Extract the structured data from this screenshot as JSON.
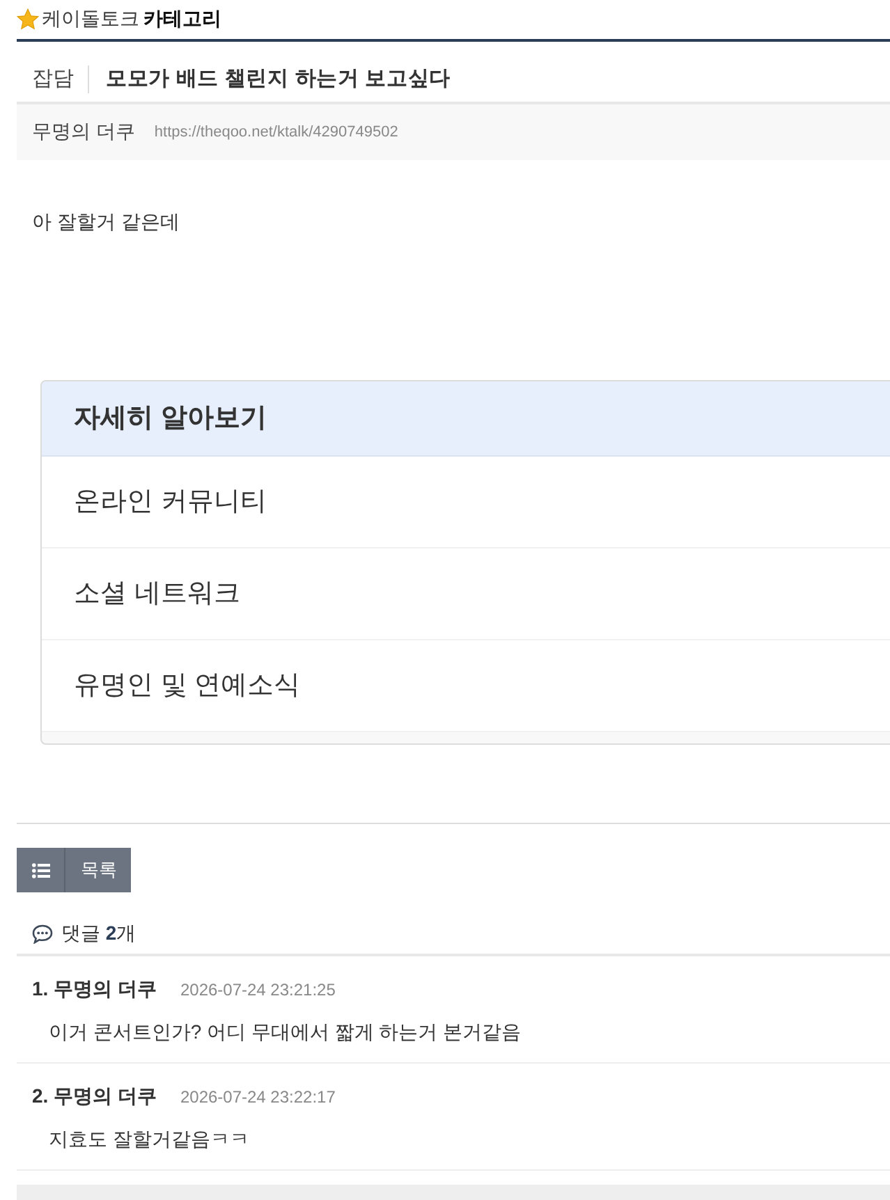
{
  "breadcrumb": {
    "board": "케이돌토크",
    "section": "카테고리"
  },
  "post": {
    "category": "잡담",
    "title": "모모가 배드 챌린지 하는거 보고싶다",
    "author": "무명의 더쿠",
    "url": "https://theqoo.net/ktalk/4290749502",
    "body": "아 잘할거 같은데"
  },
  "related": {
    "heading": "자세히 알아보기",
    "items": [
      "온라인 커뮤니티",
      "소셜 네트워크",
      "유명인 및 연예소식"
    ]
  },
  "list_button": {
    "label": "목록"
  },
  "comments_header": {
    "label": "댓글 **2**개"
  },
  "comments": [
    {
      "number": "1.",
      "author": "무명의 더쿠",
      "time": "2026-07-24 23:21:25",
      "text": "이거 콘서트인가? 어디 무대에서 짧게 하는거 본거같음"
    },
    {
      "number": "2.",
      "author": "무명의 더쿠",
      "time": "2026-07-24 23:22:17",
      "text": "지효도 잘할거같음ㅋㅋ"
    }
  ]
}
